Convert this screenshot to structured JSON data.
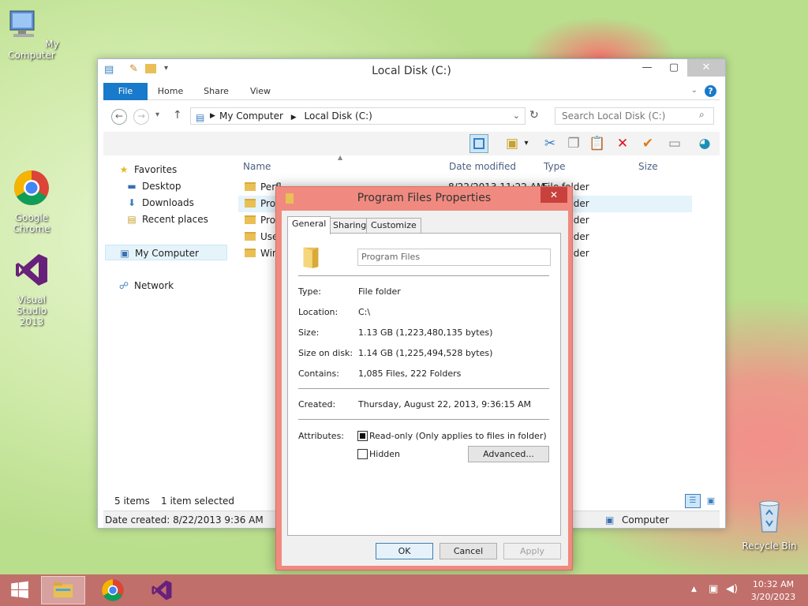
{
  "desktop": {
    "icons": [
      "My Computer",
      "Google Chrome",
      "Visual Studio 2013",
      "Recycle Bin"
    ]
  },
  "explorer": {
    "title": "Local Disk (C:)",
    "ribbon_tabs": [
      "File",
      "Home",
      "Share",
      "View"
    ],
    "address": {
      "segments": [
        "My Computer",
        "Local Disk (C:)"
      ],
      "search_placeholder": "Search Local Disk (C:)"
    },
    "nav": {
      "favorites": "Favorites",
      "desktop": "Desktop",
      "downloads": "Downloads",
      "recent": "Recent places",
      "computer": "My Computer",
      "network": "Network"
    },
    "columns": [
      "Name",
      "Date modified",
      "Type",
      "Size"
    ],
    "rows": [
      {
        "name": "Perfl",
        "date": "8/22/2013 11:22 AM",
        "type": "File folder"
      },
      {
        "name": "Prog",
        "date": "",
        "type": "File folder"
      },
      {
        "name": "Prog",
        "date": "",
        "type": "File folder"
      },
      {
        "name": "User",
        "date": "",
        "type": "File folder"
      },
      {
        "name": "Win",
        "date": "",
        "type": "File folder"
      }
    ],
    "status": {
      "items": "5 items",
      "selected": "1 item selected"
    },
    "datebar": {
      "created": "Date created: 8/22/2013 9:36 AM",
      "computer": "Computer"
    }
  },
  "dialog": {
    "title": "Program Files Properties",
    "tabs": [
      "General",
      "Sharing",
      "Customize"
    ],
    "name": "Program Files",
    "props": {
      "type_label": "Type:",
      "type": "File folder",
      "location_label": "Location:",
      "location": "C:\\",
      "size_label": "Size:",
      "size": "1.13 GB (1,223,480,135 bytes)",
      "disk_label": "Size on disk:",
      "disk": "1.14 GB (1,225,494,528 bytes)",
      "contains_label": "Contains:",
      "contains": "1,085 Files, 222 Folders",
      "created_label": "Created:",
      "created": "Thursday, August 22, 2013, 9:36:15 AM",
      "attributes_label": "Attributes:",
      "readonly": "Read-only (Only applies to files in folder)",
      "hidden": "Hidden"
    },
    "buttons": {
      "advanced": "Advanced...",
      "ok": "OK",
      "cancel": "Cancel",
      "apply": "Apply"
    }
  },
  "taskbar": {
    "time": "10:32 AM",
    "date": "3/20/2023"
  }
}
